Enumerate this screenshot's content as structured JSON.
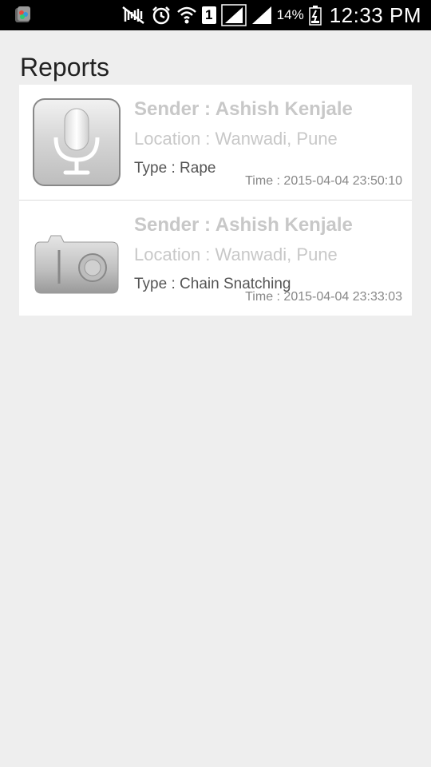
{
  "status_bar": {
    "app_icon": "gallery-app-icon",
    "icons": [
      "mute-icon",
      "alarm-icon",
      "wifi-icon",
      "sim-1-icon",
      "signal-icon",
      "signal-icon",
      "battery-icon"
    ],
    "sim_label": "1",
    "battery_percent": "14%",
    "time": "12:33 PM"
  },
  "page": {
    "title": "Reports"
  },
  "reports": [
    {
      "icon": "microphone-icon",
      "sender": "Sender : Ashish Kenjale",
      "location": "Location : Wanwadi, Pune",
      "type": "Type : Rape",
      "time": "Time : 2015-04-04 23:50:10"
    },
    {
      "icon": "camera-icon",
      "sender": "Sender : Ashish Kenjale",
      "location": "Location : Wanwadi, Pune",
      "type": "Type : Chain Snatching",
      "time": "Time : 2015-04-04 23:33:03"
    }
  ]
}
